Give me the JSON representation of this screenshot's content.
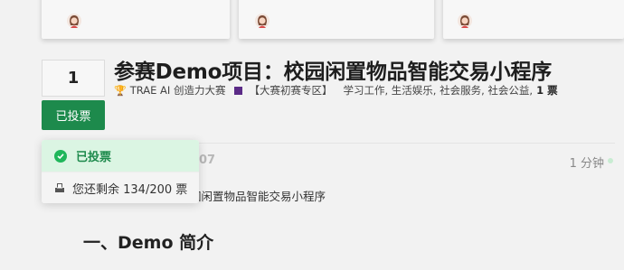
{
  "top_cards": [
    {
      "snippet": "",
      "avatar": "user-avatar"
    },
    {
      "snippet": "",
      "avatar": "user-avatar"
    },
    {
      "snippet": "",
      "avatar": "user-avatar"
    }
  ],
  "topic": {
    "vote_count": "1",
    "vote_button_label": "已投票",
    "title": "参赛Demo项目：校园闲置物品智能交易小程序",
    "meta": {
      "parent_category": "TRAE AI 创造力大赛",
      "category": "【大赛初赛专区】",
      "tags": "学习工作, 生活娱乐, 社会服务, 社会公益,",
      "votes": "1 票"
    }
  },
  "vote_menu": {
    "voted_label": "已投票",
    "remaining_label": "您还剩余 134/200 票"
  },
  "post": {
    "date_fragment": "07",
    "time_ago": "1 分钟",
    "body_fragment": "园闲置物品智能交易小程序",
    "heading": "一、Demo 简介"
  },
  "colors": {
    "accent_green": "#1d8a4c",
    "category_purple": "#5b2b87",
    "voted_bg": "#dbf5e3"
  },
  "icons": {
    "trophy": "🏆"
  }
}
